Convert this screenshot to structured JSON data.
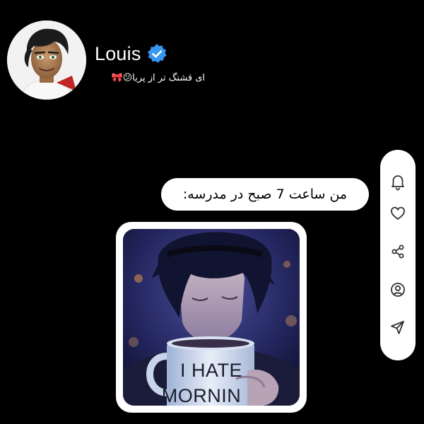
{
  "profile": {
    "name": "Louis",
    "bio": "ای قشنگ تر از پریا😕🎀",
    "verified_icon": "verified-badge-icon",
    "verified_color": "#3897f0"
  },
  "actions": [
    {
      "icon": "bell-icon"
    },
    {
      "icon": "heart-icon"
    },
    {
      "icon": "share-icon"
    },
    {
      "icon": "profile-icon"
    },
    {
      "icon": "send-icon"
    }
  ],
  "message": {
    "text": "من ساعت 7 صبح در مدرسه:"
  },
  "image": {
    "mug_line1": "I HATE",
    "mug_line2": "MORNIN"
  },
  "colors": {
    "background": "#000000",
    "surface": "#ffffff",
    "icon": "#333333"
  }
}
